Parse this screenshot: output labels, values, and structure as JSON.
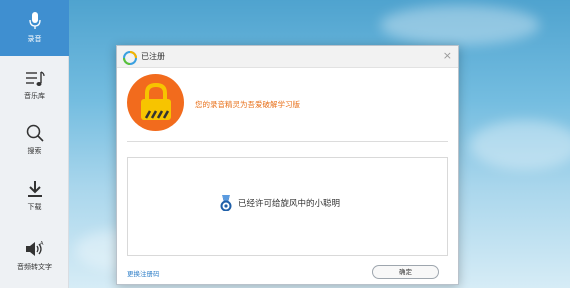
{
  "sidebar": {
    "items": [
      {
        "label": "录音",
        "icon": "microphone-icon",
        "active": true
      },
      {
        "label": "音乐库",
        "icon": "music-list-icon",
        "active": false
      },
      {
        "label": "搜索",
        "icon": "search-icon",
        "active": false
      },
      {
        "label": "下载",
        "icon": "download-icon",
        "active": false
      },
      {
        "label": "音频转文字",
        "icon": "speaker-icon",
        "active": false
      }
    ]
  },
  "dialog": {
    "title": "已注册",
    "close_symbol": "×",
    "headline": "您的录音精灵为吾爱破解学习版",
    "license_text": "已经许可给旋风中的小聪明",
    "footer_link": "更换注册码",
    "ok_label": "确定"
  },
  "colors": {
    "accent_blue": "#3f8fd0",
    "lock_orange": "#f26b1d",
    "headline_orange": "#e8701a",
    "link_blue": "#2f7fc8"
  }
}
